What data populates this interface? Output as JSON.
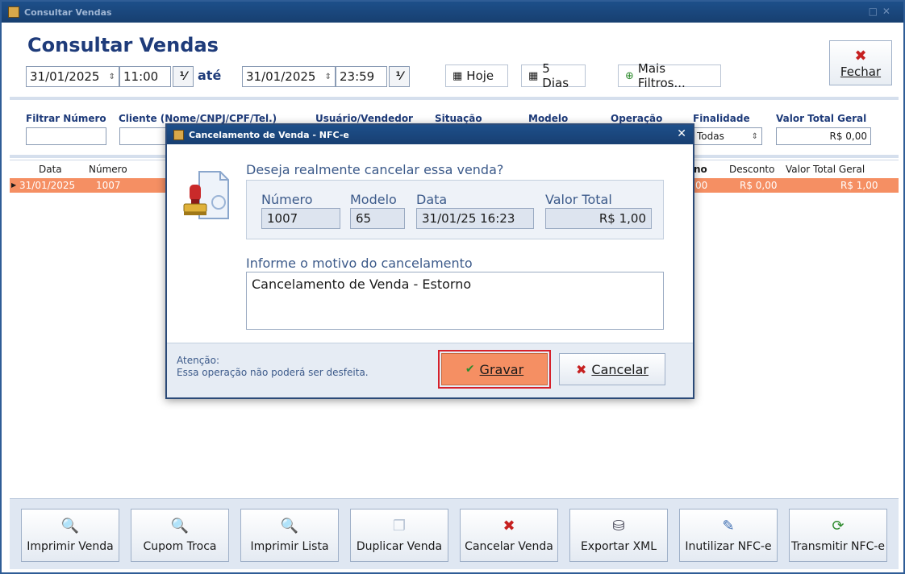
{
  "window": {
    "title": "Consultar Vendas",
    "page_title": "Consultar Vendas"
  },
  "filters": {
    "date_from": "31/01/2025",
    "time_from": "11:00",
    "until_label": "até",
    "date_to": "31/01/2025",
    "time_to": "23:59",
    "today_label": "Hoje",
    "five_days_label": "5 Dias",
    "more_filters_label": "Mais Filtros...",
    "close_label": "Fechar",
    "number_label": "Filtrar Número",
    "client_label": "Cliente  (Nome/CNPJ/CPF/Tel.)",
    "user_label": "Usuário/Vendedor",
    "status_label": "Situação",
    "model_label": "Modelo",
    "operation_label": "Operação",
    "purpose_label": "Finalidade",
    "purpose_value": "Todas",
    "total_label": "Valor Total Geral",
    "total_value": "R$ 0,00"
  },
  "grid": {
    "headers": {
      "date": "Data",
      "number": "Número",
      "no_partial": "no",
      "discount": "Desconto",
      "total": "Valor Total Geral"
    },
    "row": {
      "date": "31/01/2025",
      "number": "1007",
      "partial": "00",
      "discount": "R$ 0,00",
      "total": "R$ 1,00"
    }
  },
  "toolbar": {
    "print_sale": "Imprimir Venda",
    "exchange_coupon": "Cupom Troca",
    "print_list": "Imprimir Lista",
    "duplicate_sale": "Duplicar Venda",
    "cancel_sale": "Cancelar Venda",
    "export_xml": "Exportar XML",
    "void_nfce": "Inutilizar NFC-e",
    "transmit_nfce": "Transmitir NFC-e"
  },
  "modal": {
    "title": "Cancelamento de Venda - NFC-e",
    "question": "Deseja realmente cancelar essa venda?",
    "number_label": "Número",
    "number_value": "1007",
    "model_label": "Modelo",
    "model_value": "65",
    "date_label": "Data",
    "date_value": "31/01/25 16:23",
    "total_label": "Valor Total",
    "total_value": "R$ 1,00",
    "reason_label": "Informe o motivo do cancelamento",
    "reason_value": "Cancelamento de Venda - Estorno",
    "warning_title": "Atenção:",
    "warning_text": "Essa operação não poderá ser desfeita.",
    "save_label": "Gravar",
    "cancel_label": "Cancelar"
  },
  "colors": {
    "accent": "#1e3b7a",
    "selected_row": "#f58f63",
    "highlight_border": "#d6202a"
  }
}
